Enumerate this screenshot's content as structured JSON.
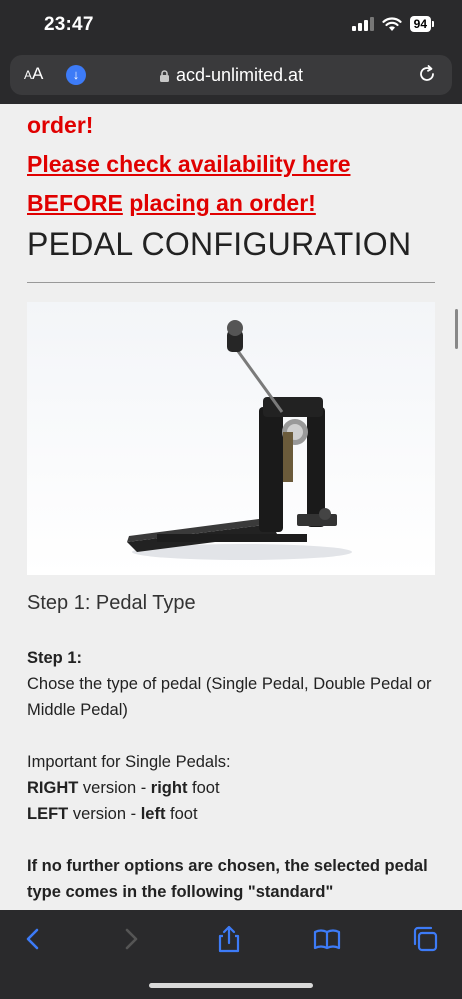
{
  "status": {
    "time": "23:47",
    "battery": "94"
  },
  "browser": {
    "aa": "AA",
    "url": "acd-unlimited.at"
  },
  "content": {
    "red_line_1": "order!",
    "red_line_2": "Please check availability here",
    "red_line_3_a": "BEFORE",
    "red_line_3_b": "placing an order!",
    "heading": "PEDAL CONFIGURATION",
    "step_title": "Step 1: Pedal Type",
    "step_label": "Step 1:",
    "step_desc": "Chose the type of pedal (Single Pedal, Double Pedal or Middle Pedal)",
    "important": "Important for Single Pedals:",
    "right_a": "RIGHT",
    "right_b": " version - ",
    "right_c": "right",
    "right_d": " foot",
    "left_a": "LEFT",
    "left_b": " version - ",
    "left_c": "left",
    "left_d": " foot",
    "options_note": "If no further options are chosen, the selected pedal type comes in the following \"standard\" configuration:"
  },
  "colors": {
    "red": "#e00000",
    "accent": "#3d7bf7"
  },
  "icons": [
    "download-icon",
    "lock-icon",
    "reload-icon",
    "back-icon",
    "forward-icon",
    "share-icon",
    "bookmarks-icon",
    "tabs-icon"
  ]
}
